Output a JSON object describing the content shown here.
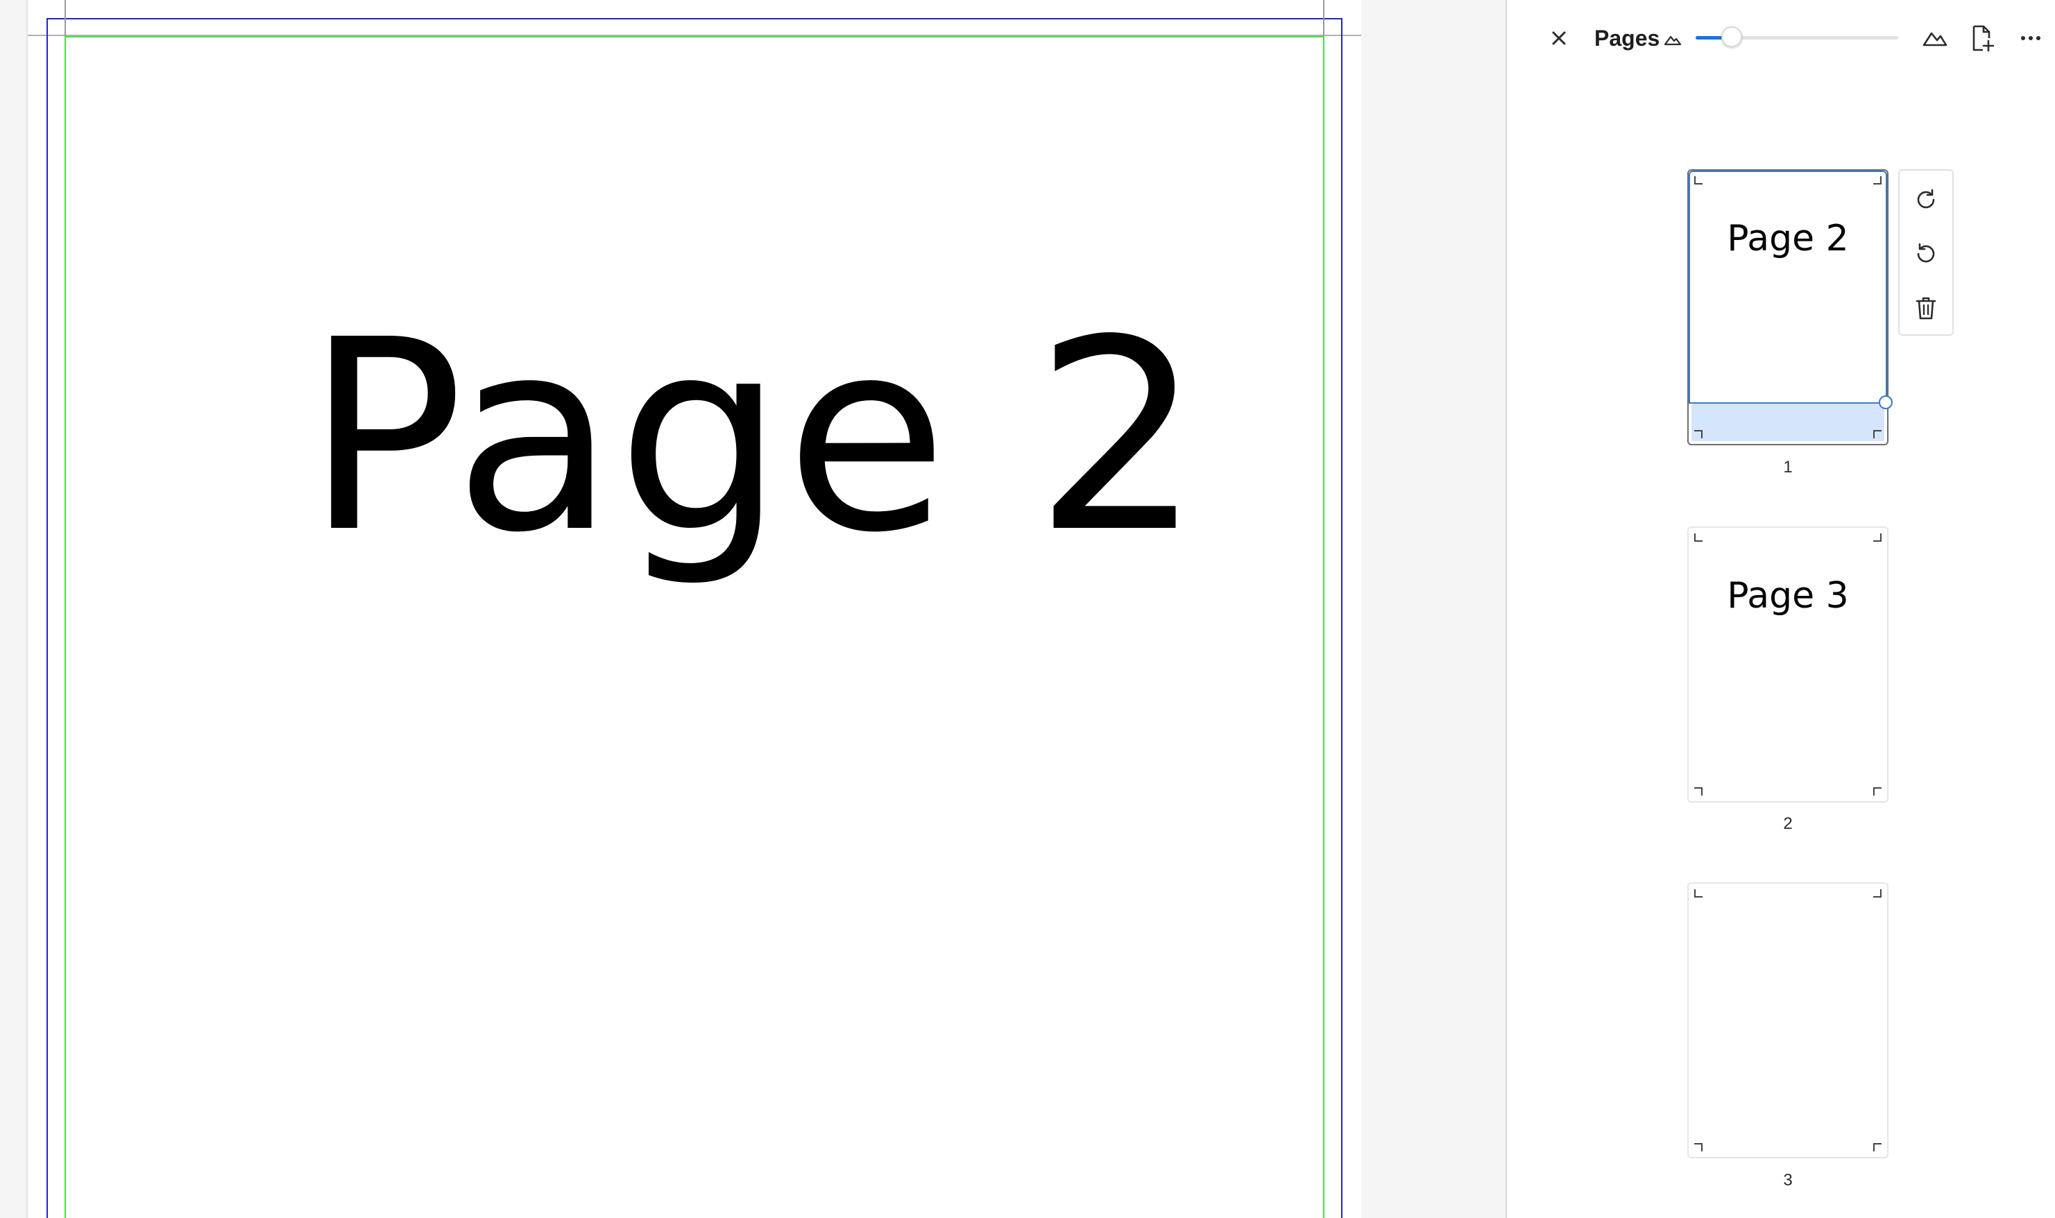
{
  "document": {
    "page_heading": "Page 2"
  },
  "panel": {
    "title": "Pages",
    "thumbnail_zoom_percent": 14,
    "icons": {
      "close": "close-icon",
      "zoom_out": "mountain-small-icon",
      "zoom_in": "mountain-large-icon",
      "add_page": "add-page-icon",
      "more": "more-icon"
    }
  },
  "thumbnails": [
    {
      "title": "Page 2",
      "number": "1",
      "selected": true
    },
    {
      "title": "Page 3",
      "number": "2",
      "selected": false
    },
    {
      "title": "",
      "number": "3",
      "selected": false
    }
  ],
  "thumbnail_actions": {
    "rotate_clockwise_icon": "rotate-clockwise-icon",
    "rotate_counterclockwise_icon": "rotate-counterclockwise-icon",
    "delete_icon": "trash-icon"
  },
  "colors": {
    "accent": "#1473e6",
    "selection_fill": "#d5e6fc",
    "margin_guide": "#2323c8",
    "bleed_guide": "#3ee83e"
  }
}
